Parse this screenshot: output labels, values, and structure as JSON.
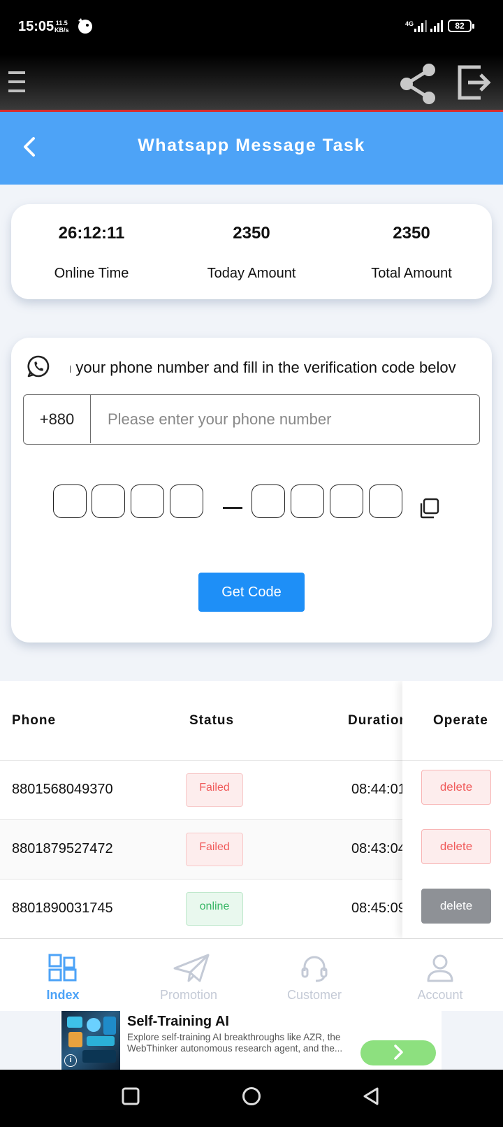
{
  "status_bar": {
    "time": "15:05",
    "speed_value": "11.5",
    "speed_unit": "KB/s",
    "network": "4G",
    "battery": "82"
  },
  "header": {
    "title": "Whatsapp Message Task"
  },
  "stats": [
    {
      "value": "26:12:11",
      "label": "Online Time"
    },
    {
      "value": "2350",
      "label": "Today Amount"
    },
    {
      "value": "2350",
      "label": "Total Amount"
    }
  ],
  "verify": {
    "instruction": "n your phone number and fill in the verification code belov",
    "country_code": "+880",
    "phone_placeholder": "Please enter your phone number",
    "get_code_label": "Get Code"
  },
  "table": {
    "columns": {
      "phone": "Phone",
      "status": "Status",
      "duration": "Duration",
      "operate": "Operate"
    },
    "rows": [
      {
        "phone": "8801568049370",
        "status": "Failed",
        "duration": "08:44:01",
        "action": "delete"
      },
      {
        "phone": "8801879527472",
        "status": "Failed",
        "duration": "08:43:04",
        "action": "delete"
      },
      {
        "phone": "8801890031745",
        "status": "online",
        "duration": "08:45:09",
        "action": "delete"
      }
    ]
  },
  "tabbar": [
    {
      "label": "Index",
      "icon": "grid-icon",
      "active": true
    },
    {
      "label": "Promotion",
      "icon": "paper-plane-icon",
      "active": false
    },
    {
      "label": "Customer",
      "icon": "headset-icon",
      "active": false
    },
    {
      "label": "Account",
      "icon": "user-icon",
      "active": false
    }
  ],
  "ad": {
    "title": "Self-Training AI",
    "description": "Explore self-training AI breakthroughs like AZR, the WebThinker autonomous research agent, and the..."
  },
  "colors": {
    "accent": "#4da3f7",
    "button": "#1e8ff7",
    "failed": "#f05a5a",
    "online": "#38b665"
  }
}
